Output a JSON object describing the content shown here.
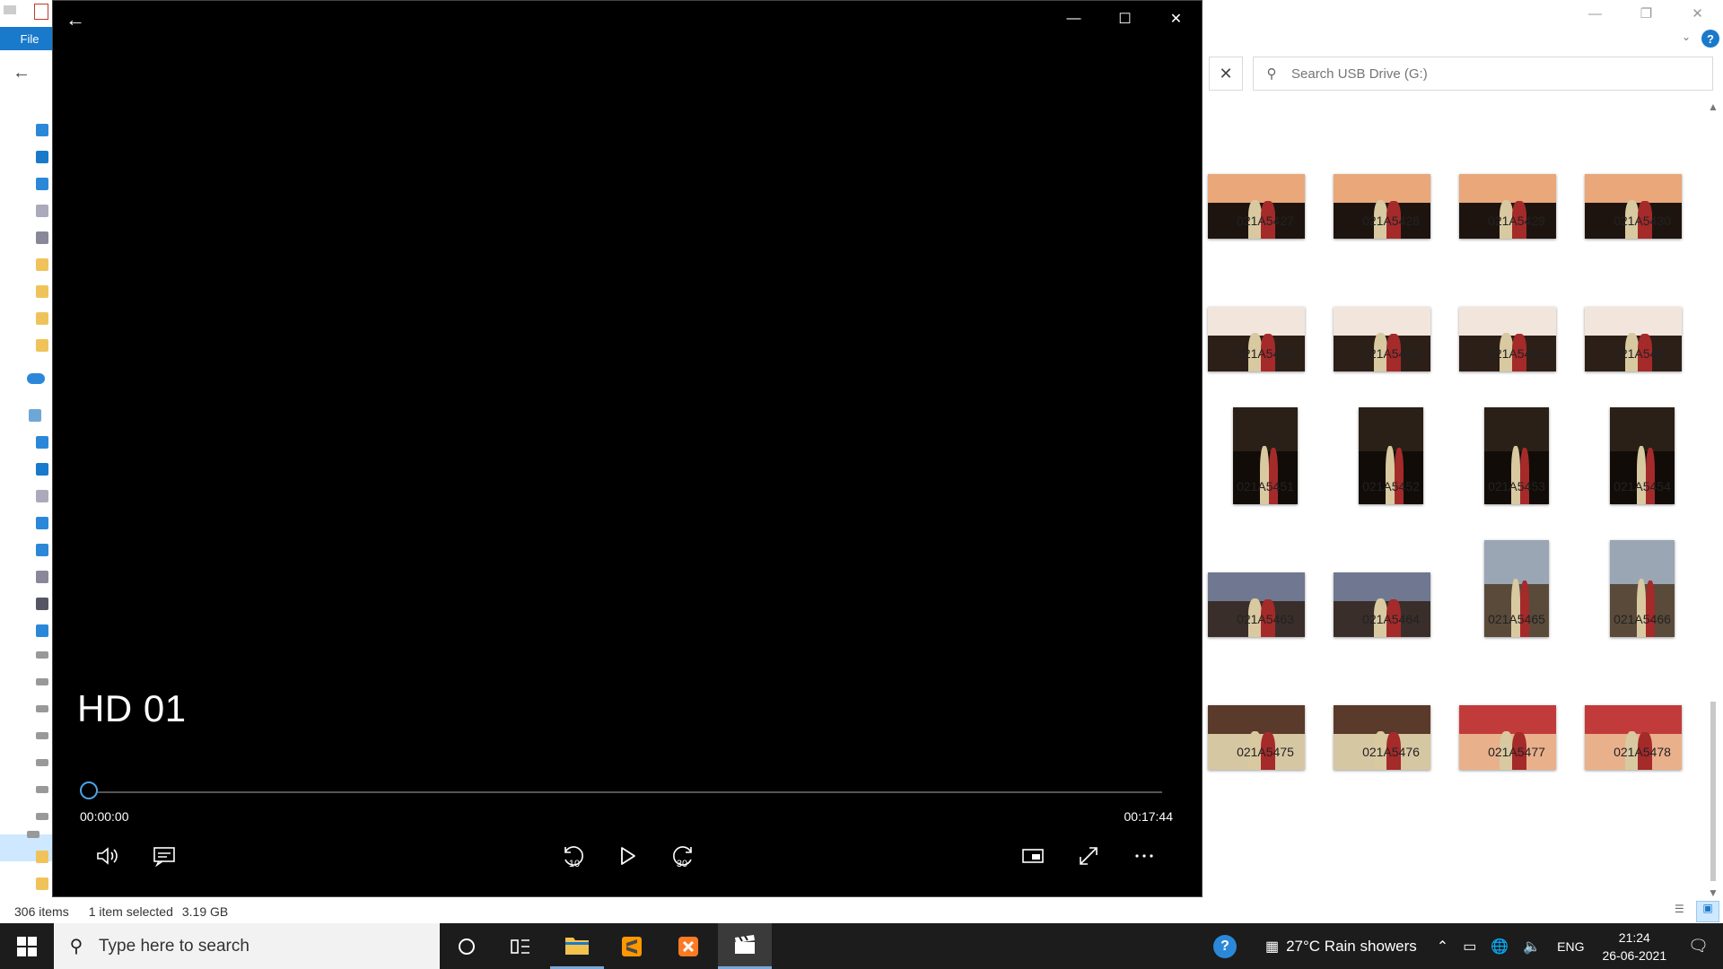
{
  "explorer": {
    "file_tab": "File",
    "search": {
      "placeholder": "Search USB Drive (G:)"
    },
    "items": [
      {
        "name": "021A5427",
        "orient": "land",
        "tone": "sunset"
      },
      {
        "name": "021A5428",
        "orient": "land",
        "tone": "sunset"
      },
      {
        "name": "021A5429",
        "orient": "land",
        "tone": "sunset"
      },
      {
        "name": "021A5430",
        "orient": "land",
        "tone": "sunset"
      },
      {
        "name": "021A5439",
        "orient": "land",
        "tone": "day"
      },
      {
        "name": "021A5440",
        "orient": "land",
        "tone": "day"
      },
      {
        "name": "021A5441",
        "orient": "land",
        "tone": "day"
      },
      {
        "name": "021A5442",
        "orient": "land",
        "tone": "day"
      },
      {
        "name": "021A5451",
        "orient": "port",
        "tone": "night"
      },
      {
        "name": "021A5452",
        "orient": "port",
        "tone": "night"
      },
      {
        "name": "021A5453",
        "orient": "port",
        "tone": "night"
      },
      {
        "name": "021A5454",
        "orient": "port",
        "tone": "night"
      },
      {
        "name": "021A5463",
        "orient": "land",
        "tone": "dusk"
      },
      {
        "name": "021A5464",
        "orient": "land",
        "tone": "dusk"
      },
      {
        "name": "021A5465",
        "orient": "port",
        "tone": "field"
      },
      {
        "name": "021A5466",
        "orient": "port",
        "tone": "field"
      },
      {
        "name": "021A5475",
        "orient": "land",
        "tone": "close"
      },
      {
        "name": "021A5476",
        "orient": "land",
        "tone": "close"
      },
      {
        "name": "021A5477",
        "orient": "land",
        "tone": "ceremony"
      },
      {
        "name": "021A5478",
        "orient": "land",
        "tone": "ceremony"
      }
    ],
    "status": {
      "count": "306 items",
      "selected": "1 item selected",
      "size": "3.19 GB"
    }
  },
  "player": {
    "title": "HD 01",
    "time_current": "00:00:00",
    "time_total": "00:17:44",
    "progress": 0,
    "skip_back_label": "10",
    "skip_forward_label": "30"
  },
  "taskbar": {
    "search_placeholder": "Type here to search",
    "weather": "27°C  Rain showers",
    "language": "ENG",
    "time": "21:24",
    "date": "26-06-2021"
  },
  "colors": {
    "accent": "#1979ca",
    "seek_knob": "#4ca3e6",
    "taskbar": "#1c1c1c"
  }
}
